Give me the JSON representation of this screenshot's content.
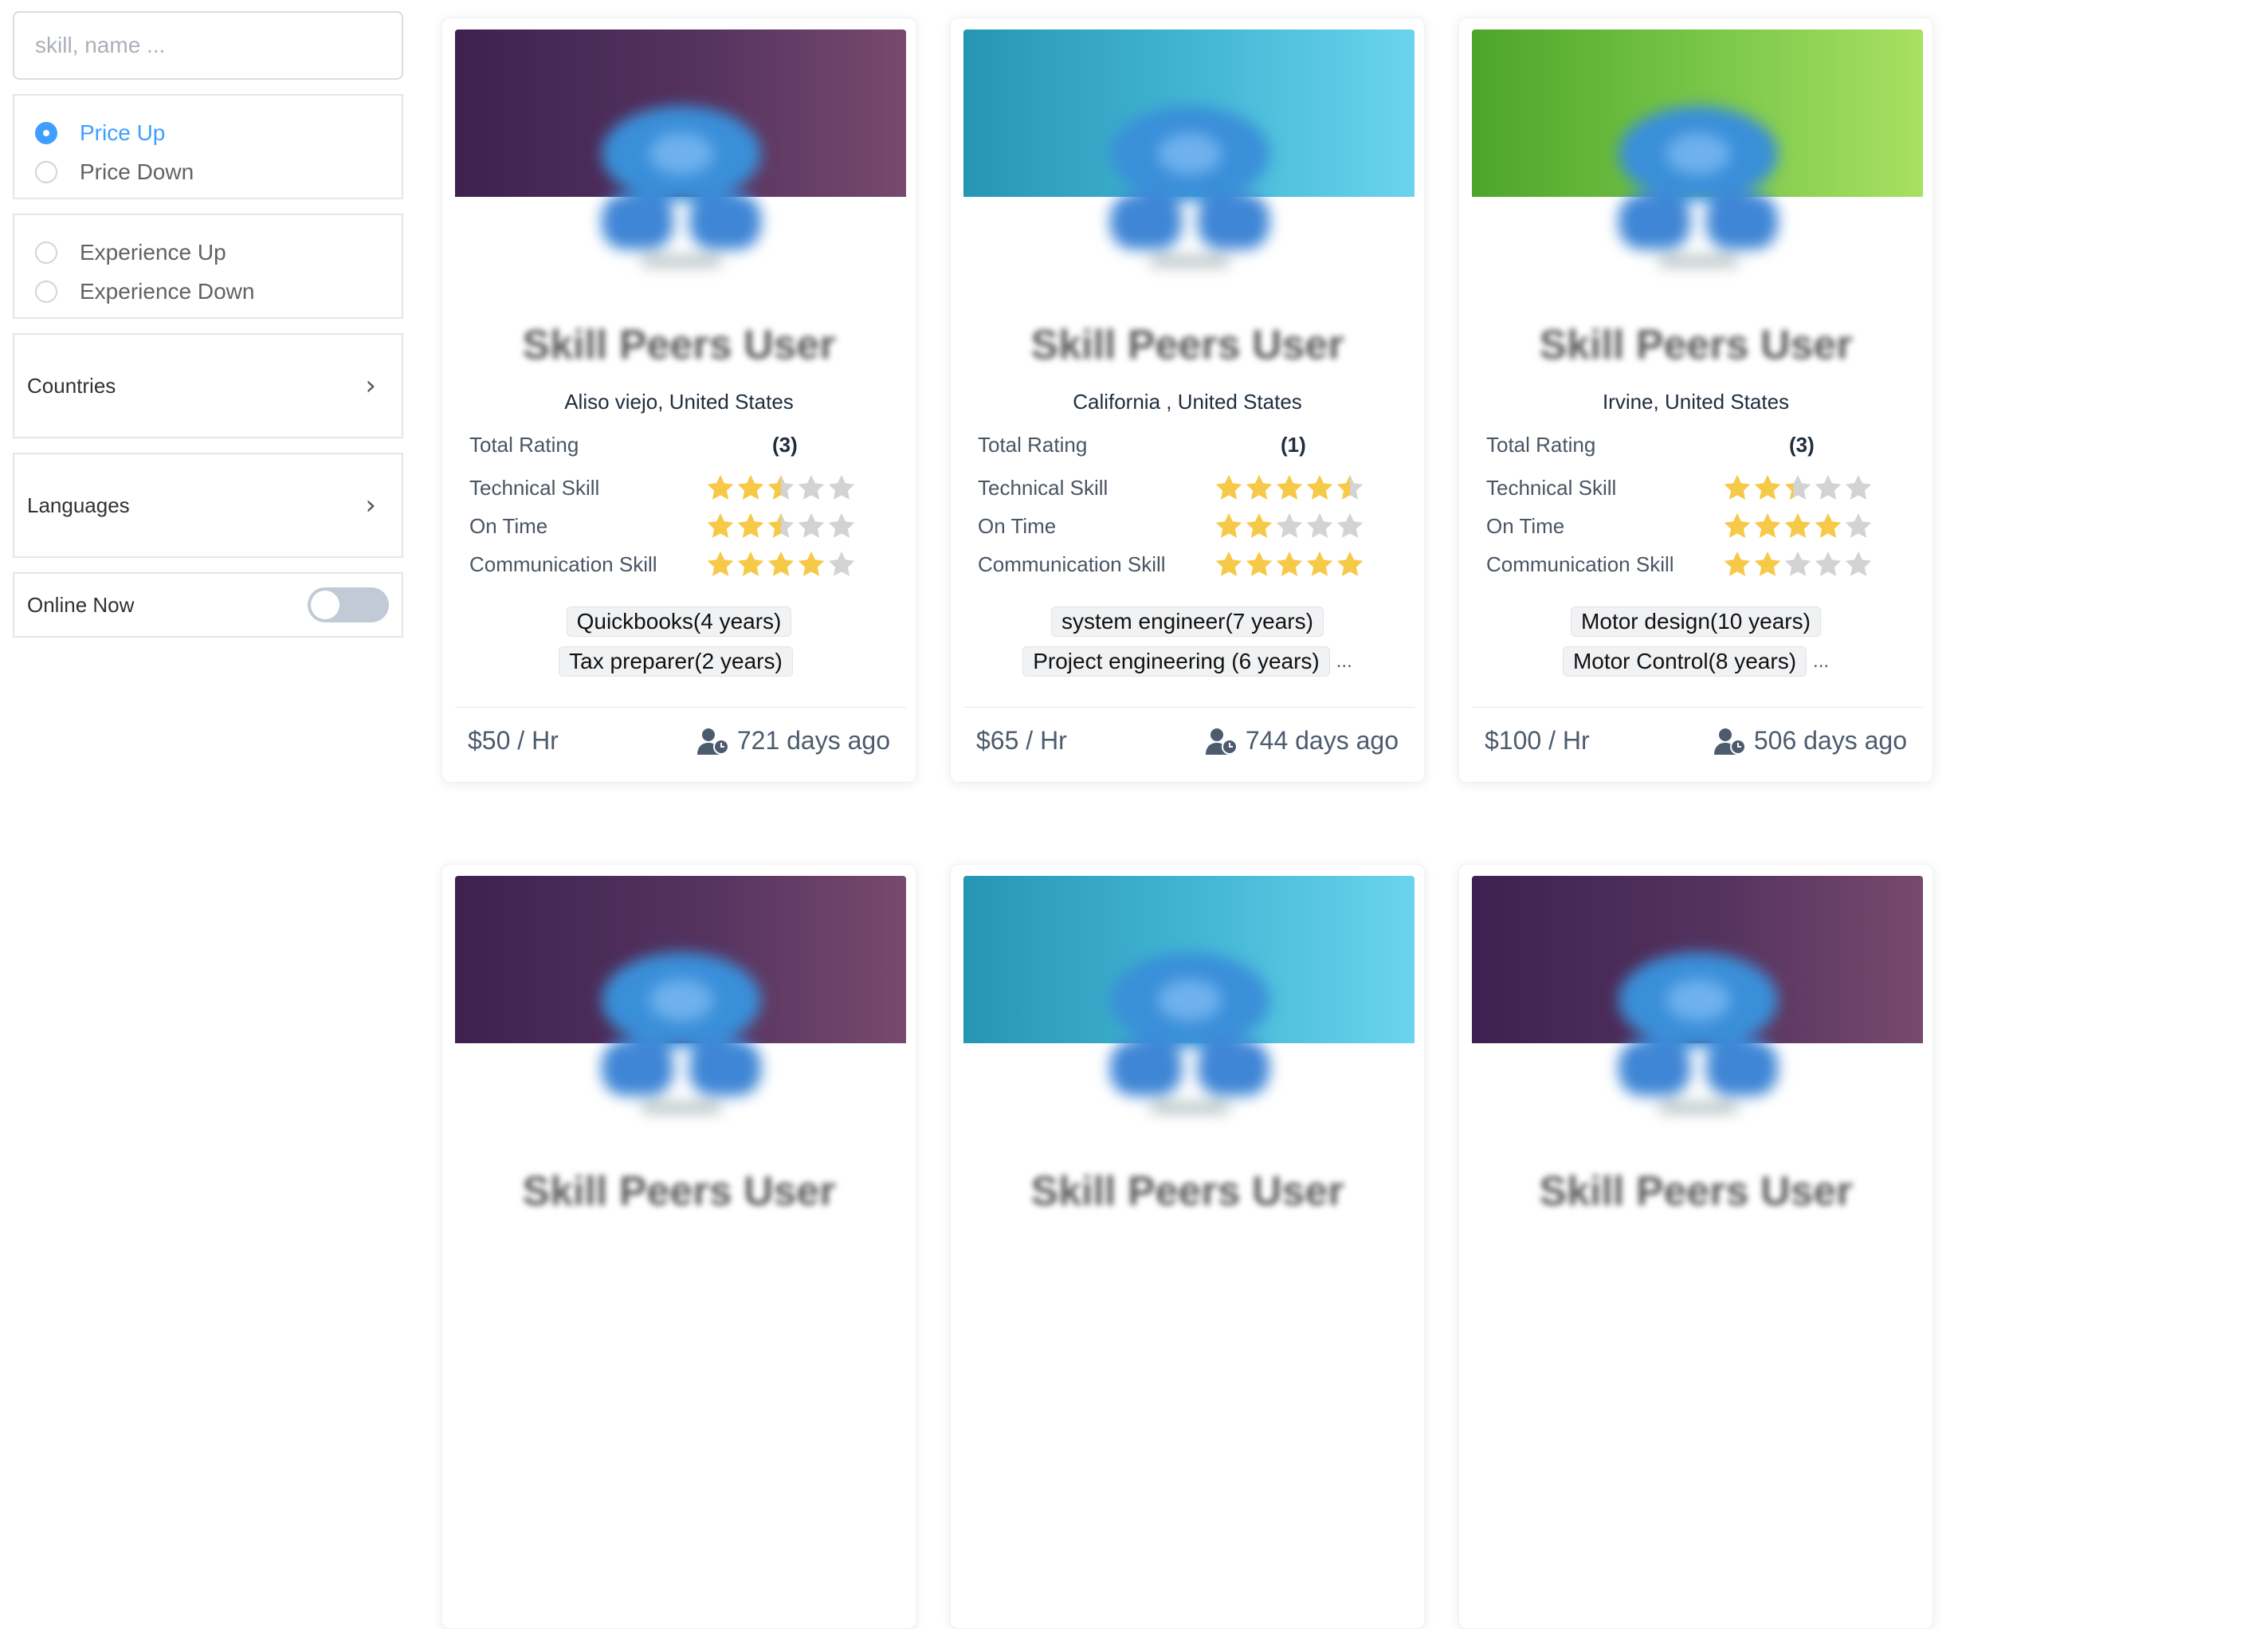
{
  "search": {
    "placeholder": "skill, name ..."
  },
  "sort_price": {
    "options": [
      "Price Up",
      "Price Down"
    ],
    "selected": "Price Up"
  },
  "sort_experience": {
    "options": [
      "Experience Up",
      "Experience Down"
    ]
  },
  "filters": {
    "countries": "Countries",
    "languages": "Languages",
    "online_now": "Online Now"
  },
  "colors": {
    "accent": "#409eff",
    "star": "#f7c948",
    "star_empty": "#d3d3d3"
  },
  "labels": {
    "total_rating": "Total Rating",
    "technical": "Technical Skill",
    "on_time": "On Time",
    "communication": "Communication Skill"
  },
  "cards": [
    {
      "name": "Skill Peers User",
      "location": "Aliso viejo, United States",
      "total_rating": "(3)",
      "technical": 2.5,
      "on_time": 2.5,
      "communication": 4,
      "tags": [
        "Quickbooks(4 years)",
        "Tax preparer(2 years)"
      ],
      "more": "",
      "price": "$50 / Hr",
      "ago": "721 days ago",
      "banner": "purple"
    },
    {
      "name": "Skill Peers User",
      "location": "California , United States",
      "total_rating": "(1)",
      "technical": 4.5,
      "on_time": 2,
      "communication": 5,
      "tags": [
        "system engineer(7 years)",
        "Project engineering (6 years)"
      ],
      "more": "...",
      "price": "$65 / Hr",
      "ago": "744 days ago",
      "banner": "teal"
    },
    {
      "name": "Skill Peers User",
      "location": "Irvine, United States",
      "total_rating": "(3)",
      "technical": 2.33,
      "on_time": 4,
      "communication": 2,
      "tags": [
        "Motor design(10 years)",
        "Motor Control(8 years)"
      ],
      "more": "...",
      "price": "$100 / Hr",
      "ago": "506 days ago",
      "banner": "green"
    },
    {
      "name": "Skill Peers User",
      "banner": "purple"
    },
    {
      "name": "Skill Peers User",
      "banner": "teal"
    },
    {
      "name": "Skill Peers User",
      "banner": "purple"
    }
  ]
}
